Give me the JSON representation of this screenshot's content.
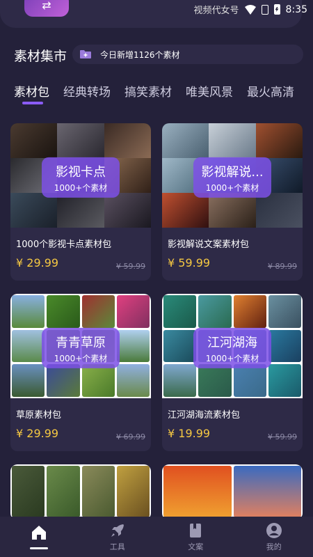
{
  "status": {
    "carrier": "视频代女号",
    "time": "8:35"
  },
  "header": {
    "title": "素材集市",
    "notice": "今日新增1126个素材"
  },
  "tabs": [
    "素材包",
    "经典转场",
    "搞笑素材",
    "唯美风景",
    "最火高清"
  ],
  "cards": [
    {
      "badge_title": "影视卡点",
      "badge_sub": "1000+个素材",
      "name": "1000个影视卡点素材包",
      "price": "¥ 29.99",
      "old_price": "¥ 59.99"
    },
    {
      "badge_title": "影视解说...",
      "badge_sub": "1000+个素材",
      "name": "影视解说文案素材包",
      "price": "¥ 59.99",
      "old_price": "¥ 89.99"
    },
    {
      "badge_title": "青青草原",
      "badge_sub": "1000+个素材",
      "name": "草原素材包",
      "price": "¥ 29.99",
      "old_price": "¥ 69.99"
    },
    {
      "badge_title": "江河湖海",
      "badge_sub": "1000+个素材",
      "name": "江河湖海流素材包",
      "price": "¥ 19.99",
      "old_price": "¥ 59.99"
    }
  ],
  "nav": [
    {
      "label": "",
      "icon": "home-icon"
    },
    {
      "label": "工具",
      "icon": "rocket-icon"
    },
    {
      "label": "文案",
      "icon": "book-icon"
    },
    {
      "label": "我的",
      "icon": "user-icon"
    }
  ],
  "colors": {
    "background": "#24213a",
    "card": "#2e2a47",
    "accent": "#8b5cf6",
    "price": "#f5c842"
  }
}
